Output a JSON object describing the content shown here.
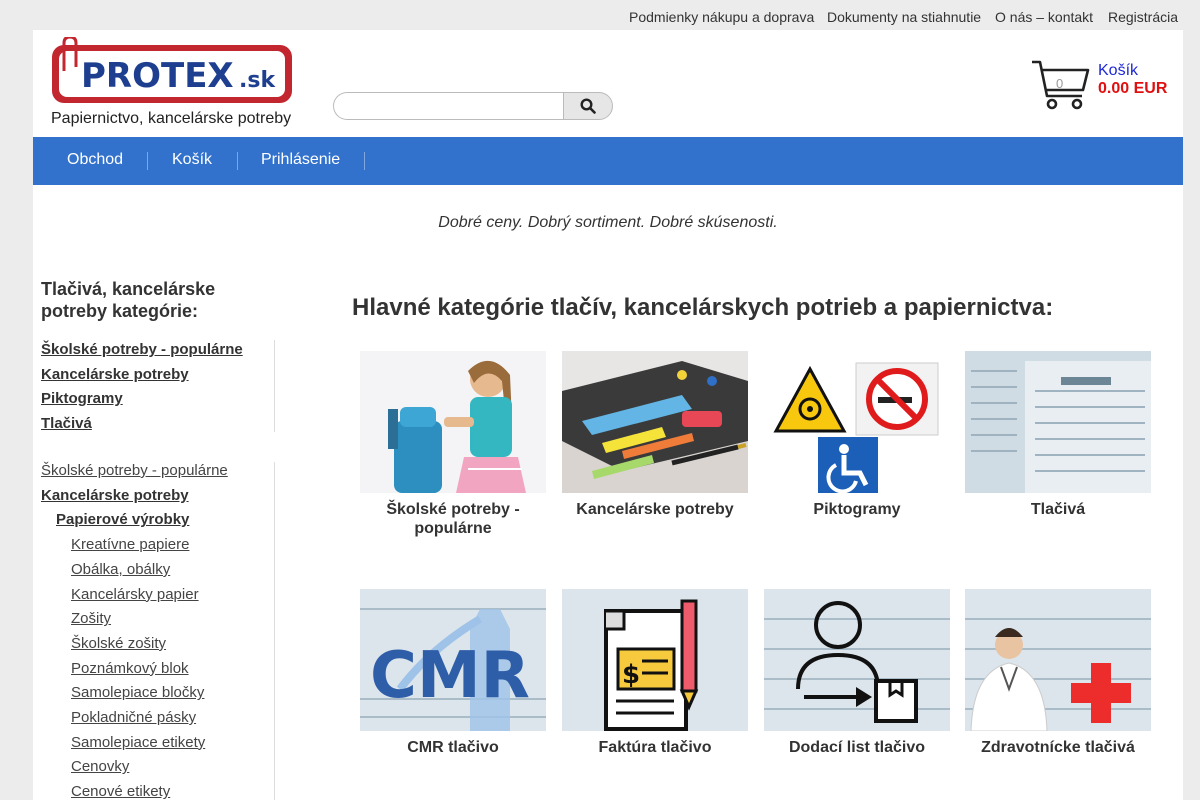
{
  "top_links": [
    "Podmienky nákupu a doprava",
    "Dokumenty na stiahnutie",
    "O nás – kontakt",
    "Registrácia"
  ],
  "logo": {
    "text": "PROTEX",
    "suffix": ".sk"
  },
  "tagline": "Papiernictvo, kancelárske potreby",
  "search": {
    "placeholder": ""
  },
  "cart": {
    "title": "Košík",
    "count": "0",
    "total": "0.00 EUR"
  },
  "nav": [
    "Obchod",
    "Košík",
    "Prihlásenie"
  ],
  "slogan": "Dobré ceny. Dobrý sortiment. Dobré skúsenosti.",
  "sidebar": {
    "title": "Tlačivá, kancelárske potreby kategórie:",
    "top_categories": [
      "Školské potreby - populárne",
      "Kancelárske potreby",
      "Piktogramy",
      "Tlačivá"
    ],
    "tree": [
      {
        "label": "Školské potreby - populárne",
        "level": 0,
        "bold": false
      },
      {
        "label": "Kancelárske potreby",
        "level": 0,
        "bold": true
      },
      {
        "label": "Papierové výrobky",
        "level": 1,
        "bold": true
      },
      {
        "label": "Kreatívne papiere",
        "level": 2,
        "bold": false
      },
      {
        "label": "Obálka, obálky",
        "level": 2,
        "bold": false
      },
      {
        "label": "Kancelársky papier",
        "level": 2,
        "bold": false
      },
      {
        "label": "Zošity",
        "level": 2,
        "bold": false
      },
      {
        "label": "Školské zošity",
        "level": 2,
        "bold": false
      },
      {
        "label": "Poznámkový blok",
        "level": 2,
        "bold": false
      },
      {
        "label": "Samolepiace bločky",
        "level": 2,
        "bold": false
      },
      {
        "label": "Pokladničné pásky",
        "level": 2,
        "bold": false
      },
      {
        "label": "Samolepiace etikety",
        "level": 2,
        "bold": false
      },
      {
        "label": "Cenovky",
        "level": 2,
        "bold": false
      },
      {
        "label": "Cenové etikety",
        "level": 2,
        "bold": false
      }
    ]
  },
  "main": {
    "title": "Hlavné kategórie tlačív, kancelárskych potrieb a papiernictva:",
    "categories": [
      {
        "label": "Školské potreby - populárne",
        "icon": "school-bag-photo"
      },
      {
        "label": "Kancelárske potreby",
        "icon": "office-supplies-photo"
      },
      {
        "label": "Piktogramy",
        "icon": "pictogram-signs"
      },
      {
        "label": "Tlačivá",
        "icon": "tax-form-photo"
      },
      {
        "label": "CMR tlačivo",
        "icon": "cmr-form"
      },
      {
        "label": "Faktúra tlačivo",
        "icon": "invoice-form"
      },
      {
        "label": "Dodací list tlačivo",
        "icon": "delivery-note-form"
      },
      {
        "label": "Zdravotnícke tlačivá",
        "icon": "medical-form"
      }
    ]
  },
  "colors": {
    "nav_bg": "#3272cc",
    "cart_title": "#1d27d6",
    "cart_total": "#e01010",
    "logo_red": "#c2262e",
    "logo_blue": "#1e3f8f"
  }
}
